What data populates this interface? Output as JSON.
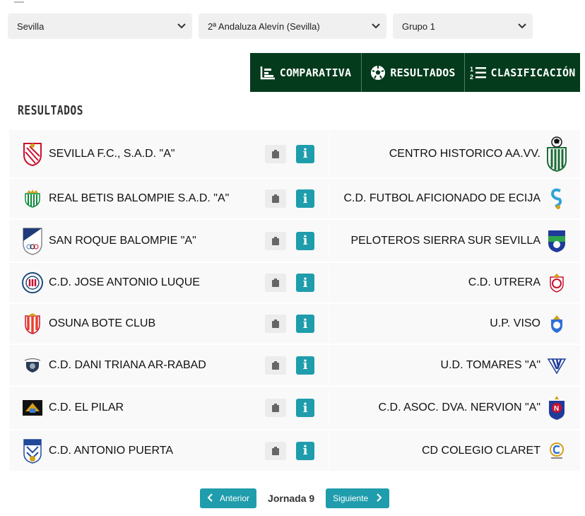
{
  "filters": {
    "province": "Sevilla",
    "competition": "2ª Andaluza Alevín (Sevilla)",
    "group": "Grupo 1"
  },
  "tabs": [
    {
      "label": "COMPARATIVA",
      "icon": "chart-icon"
    },
    {
      "label": "RESULTADOS",
      "icon": "football-icon"
    },
    {
      "label": "CLASIFICACIÓN",
      "icon": "numbered-list-icon"
    }
  ],
  "section_title": "RESULTADOS",
  "matches": [
    {
      "home": "SEVILLA F.C., S.A.D. \"A\"",
      "away": "CENTRO HISTORICO AA.VV."
    },
    {
      "home": "REAL BETIS BALOMPIE S.A.D. \"A\"",
      "away": "C.D. FUTBOL AFICIONADO DE ECIJA"
    },
    {
      "home": "SAN ROQUE BALOMPIE \"A\"",
      "away": "PELOTEROS SIERRA SUR SEVILLA"
    },
    {
      "home": "C.D. JOSE ANTONIO LUQUE",
      "away": "C.D. UTRERA"
    },
    {
      "home": "OSUNA BOTE CLUB",
      "away": "U.P. VISO"
    },
    {
      "home": "C.D. DANI TRIANA AR-RABAD",
      "away": "U.D. TOMARES \"A\""
    },
    {
      "home": "C.D. EL PILAR",
      "away": "C.D. ASOC. DVA. NERVION \"A\""
    },
    {
      "home": "C.D. ANTONIO PUERTA",
      "away": "CD COLEGIO CLARET"
    }
  ],
  "info_label": "i",
  "pager": {
    "prev": "Anterior",
    "current": "Jornada 9",
    "next": "Siguiente"
  },
  "colors": {
    "tab_bg": "#033b1c",
    "accent": "#1f9dac",
    "row_bg": "#f9f9f9"
  }
}
